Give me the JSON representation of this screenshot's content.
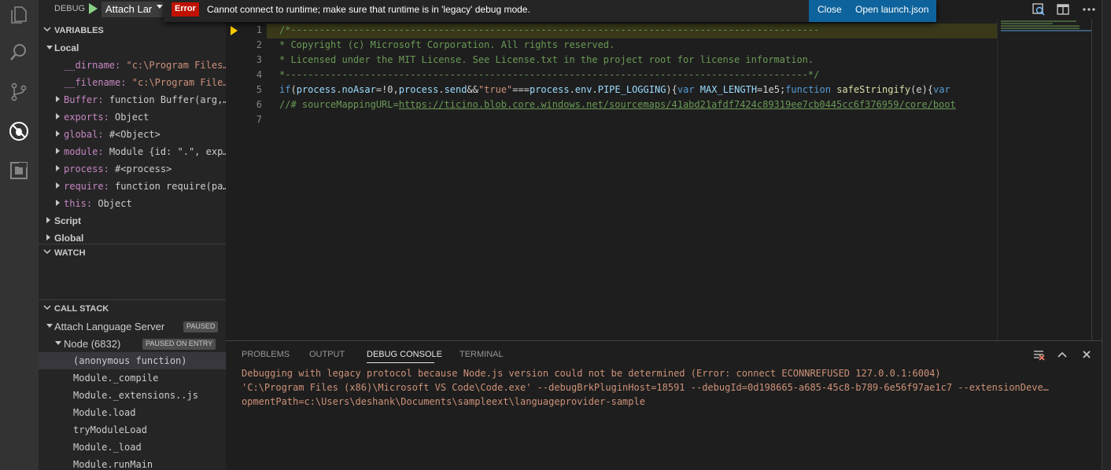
{
  "debug_toolbar": {
    "label": "DEBUG",
    "config": "Attach Lar"
  },
  "variables": {
    "header": "VARIABLES",
    "local_label": "Local",
    "items": [
      {
        "key": "__dirname:",
        "value": "\"c:\\Program Files…"
      },
      {
        "key": "__filename:",
        "value": "\"c:\\Program File…"
      },
      {
        "key": "Buffer:",
        "value": "function Buffer(arg,…"
      },
      {
        "key": "exports:",
        "value": "Object"
      },
      {
        "key": "global:",
        "value": "#<Object>"
      },
      {
        "key": "module:",
        "value": "Module {id: \".\", exp…"
      },
      {
        "key": "process:",
        "value": "#<process>"
      },
      {
        "key": "require:",
        "value": "function require(pa…"
      },
      {
        "key": "this:",
        "value": "Object"
      }
    ],
    "script_label": "Script",
    "global_label": "Global"
  },
  "watch": {
    "header": "WATCH"
  },
  "callstack": {
    "header": "CALL STACK",
    "session": "Attach Language Server",
    "session_badge": "PAUSED",
    "thread": "Node (6832)",
    "thread_badge": "PAUSED ON ENTRY",
    "frames": [
      "(anonymous function)",
      "Module._compile",
      "Module._extensions..js",
      "Module.load",
      "tryModuleLoad",
      "Module._load",
      "Module.runMain"
    ]
  },
  "notification": {
    "severity": "Error",
    "message": "Cannot connect to runtime; make sure that runtime is in 'legacy' debug mode.",
    "close_label": "Close",
    "open_label": "Open launch.json"
  },
  "editor": {
    "line_numbers": [
      "1",
      "2",
      "3",
      "4",
      "5",
      "6",
      "7"
    ],
    "line1": "/*---------------------------------------------------------------------------------------------",
    "line2": " *  Copyright (c) Microsoft Corporation. All rights reserved.",
    "line3": " *  Licensed under the MIT License. See License.txt in the project root for license information.",
    "line4": " *--------------------------------------------------------------------------------------------*/",
    "line5": {
      "t1": "if",
      "t2": "(",
      "t3": "process",
      "t4": ".",
      "t5": "noAsar",
      "t6": "=!0,",
      "t7": "process",
      "t8": ".",
      "t9": "send",
      "t10": "&&",
      "t11": "\"true\"",
      "t12": "===",
      "t13": "process",
      "t14": ".",
      "t15": "env",
      "t16": ".",
      "t17": "PIPE_LOGGING",
      "t18": "){",
      "t19": "var",
      "t20": " ",
      "t21": "MAX_LENGTH",
      "t22": "=1e5;",
      "t23": "function",
      "t24": " ",
      "t25": "safeStringify",
      "t26": "(e){",
      "t27": "var"
    },
    "line6_prefix": "//# sourceMappingURL=",
    "line6_link": "https://ticino.blob.core.windows.net/sourcemaps/41abd21afdf7424c89319ee7cb0445cc6f376959/core/boot"
  },
  "panel": {
    "tabs": [
      "PROBLEMS",
      "OUTPUT",
      "DEBUG CONSOLE",
      "TERMINAL"
    ],
    "active_tab": "DEBUG CONSOLE",
    "lines": [
      "Debugging with legacy protocol because Node.js version could not be determined (Error: connect ECONNREFUSED 127.0.0.1:6004)",
      "'C:\\Program Files (x86)\\Microsoft VS Code\\Code.exe' --debugBrkPluginHost=18591 --debugId=0d198665-a685-45c8-b789-6e56f97ae1c7 --extensionDeve…",
      "opmentPath=c:\\Users\\deshank\\Documents\\sampleext\\languageprovider-sample"
    ]
  },
  "colors": {
    "activity_bar": "#333333",
    "sidebar": "#252526",
    "editor": "#1e1e1e",
    "error_badge": "#be1100",
    "action_blue": "#0e639c",
    "console_text": "#ce9178"
  }
}
